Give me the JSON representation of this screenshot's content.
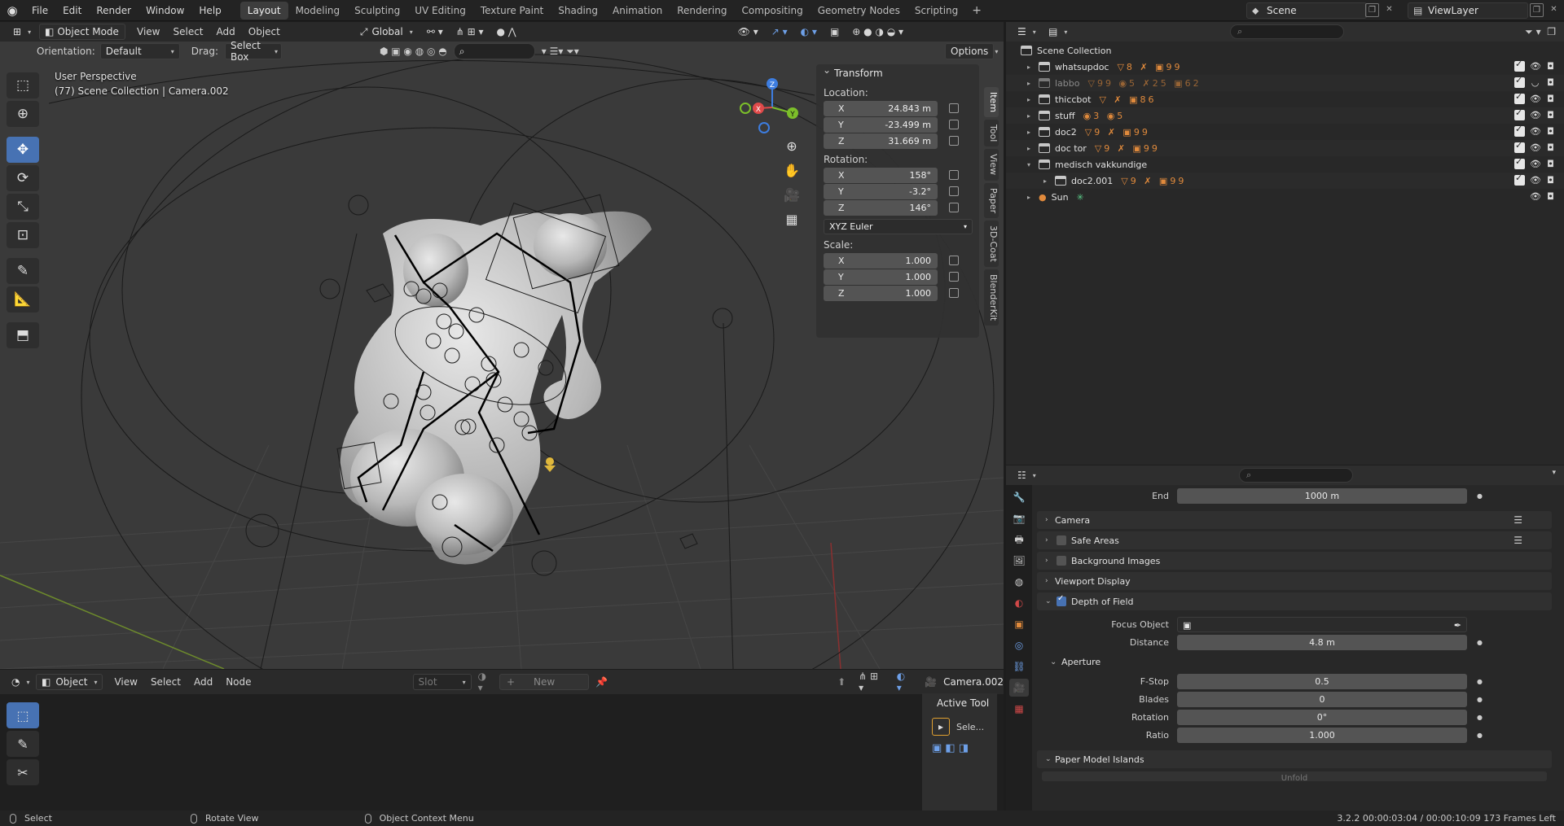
{
  "app": {
    "menus": [
      "File",
      "Edit",
      "Render",
      "Window",
      "Help"
    ],
    "workspaces": [
      "Layout",
      "Modeling",
      "Sculpting",
      "UV Editing",
      "Texture Paint",
      "Shading",
      "Animation",
      "Rendering",
      "Compositing",
      "Geometry Nodes",
      "Scripting"
    ],
    "active_workspace": "Layout",
    "add_tab": "+",
    "scene": "Scene",
    "view_layer": "ViewLayer"
  },
  "viewport": {
    "mode": "Object Mode",
    "menus": [
      "View",
      "Select",
      "Add",
      "Object"
    ],
    "transform_orientation": "Global",
    "orientation_label": "Orientation:",
    "orientation_value": "Default",
    "drag_label": "Drag:",
    "drag_value": "Select Box",
    "options_label": "Options",
    "info_line1": "User Perspective",
    "info_line2": "(77) Scene Collection | Camera.002",
    "gizmo_axes": {
      "x": "X",
      "y": "Y",
      "z": "Z"
    }
  },
  "transform_panel": {
    "title": "Transform",
    "location_label": "Location:",
    "location": [
      {
        "axis": "X",
        "value": "24.843 m"
      },
      {
        "axis": "Y",
        "value": "-23.499 m"
      },
      {
        "axis": "Z",
        "value": "31.669 m"
      }
    ],
    "rotation_label": "Rotation:",
    "rotation": [
      {
        "axis": "X",
        "value": "158°"
      },
      {
        "axis": "Y",
        "value": "-3.2°"
      },
      {
        "axis": "Z",
        "value": "146°"
      }
    ],
    "rotation_mode": "XYZ Euler",
    "scale_label": "Scale:",
    "scale": [
      {
        "axis": "X",
        "value": "1.000"
      },
      {
        "axis": "Y",
        "value": "1.000"
      },
      {
        "axis": "Z",
        "value": "1.000"
      }
    ]
  },
  "sidebar_tabs": [
    "Item",
    "Tool",
    "View",
    "Paper",
    "3D-Coat",
    "BlenderKit"
  ],
  "node_editor": {
    "editor_type": "Object",
    "menus": [
      "View",
      "Select",
      "Add",
      "Node"
    ],
    "slot_label": "Slot",
    "new_label": "New",
    "object_name": "Camera.002",
    "side_title": "Active Tool",
    "side_tool_label": "Sele..."
  },
  "outliner": {
    "root": "Scene Collection",
    "rows": [
      {
        "name": "whatsupdoc",
        "badges": "▽8 ✗ ▣99",
        "dim": false,
        "indent": 0
      },
      {
        "name": "labbo",
        "badges": "▽99 ◉5 ✗25 ▣62",
        "dim": true,
        "indent": 0
      },
      {
        "name": "thiccbot",
        "badges": "▽ ✗ ▣86",
        "dim": false,
        "indent": 0
      },
      {
        "name": "stuff",
        "badges": "◉3 ◉5",
        "dim": false,
        "indent": 0
      },
      {
        "name": "doc2",
        "badges": "▽9 ✗ ▣99",
        "dim": false,
        "indent": 0
      },
      {
        "name": "doc tor",
        "badges": "▽9 ✗ ▣99",
        "dim": false,
        "indent": 0
      },
      {
        "name": "medisch vakkundige",
        "badges": "",
        "dim": false,
        "indent": 0
      },
      {
        "name": "doc2.001",
        "badges": "▽9 ✗ ▣99",
        "dim": false,
        "indent": 1
      },
      {
        "name": "Sun",
        "badges": "✳",
        "dim": false,
        "indent": 0
      }
    ]
  },
  "properties": {
    "end_label": "End",
    "end_value": "1000 m",
    "panels": [
      {
        "label": "Camera",
        "checkbox": false
      },
      {
        "label": "Safe Areas",
        "checkbox": true
      },
      {
        "label": "Background Images",
        "checkbox": true
      },
      {
        "label": "Viewport Display",
        "checkbox": false
      }
    ],
    "dof_label": "Depth of Field",
    "focus_object_label": "Focus Object",
    "distance_label": "Distance",
    "distance_value": "4.8 m",
    "aperture_label": "Aperture",
    "fstop_label": "F-Stop",
    "fstop_value": "0.5",
    "blades_label": "Blades",
    "blades_value": "0",
    "rotation_label": "Rotation",
    "rotation_value": "0°",
    "ratio_label": "Ratio",
    "ratio_value": "1.000",
    "paper_panel_label": "Paper Model Islands",
    "unfold_label": "Unfold"
  },
  "statusbar": {
    "select": "Select",
    "rotate": "Rotate View",
    "context": "Object Context Menu",
    "right_info": "3.2.2  00:00:03:04 / 00:00:10:09  173 Frames Left"
  },
  "colors": {
    "accent": "#4772b3",
    "axis_x": "#e04a4a",
    "axis_y": "#7cbf2a",
    "axis_z": "#3d7de0",
    "object_orange": "#e08a3c"
  }
}
